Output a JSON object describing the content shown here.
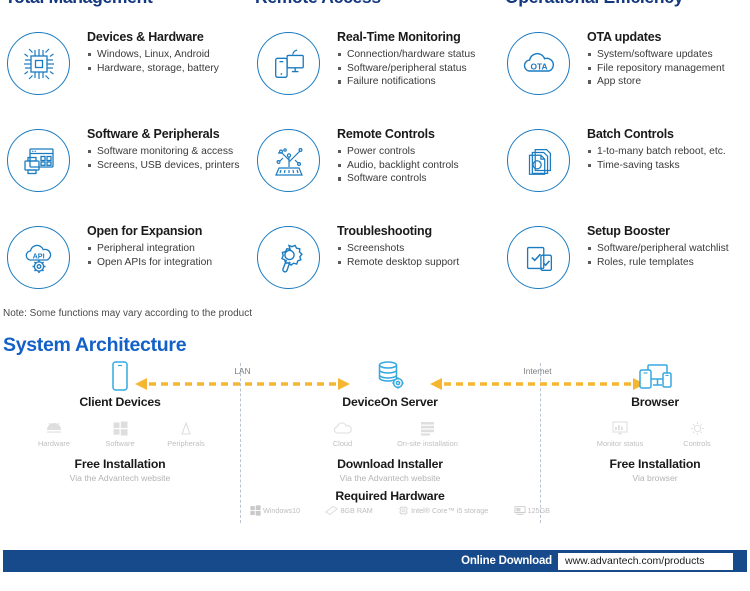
{
  "columns": [
    {
      "title": "Total Management"
    },
    {
      "title": "Remote Access"
    },
    {
      "title": "Operational Efficiency"
    }
  ],
  "features": [
    {
      "icon": "chip-icon",
      "title": "Devices & Hardware",
      "bullets": [
        "Windows, Linux, Android",
        "Hardware, storage, battery"
      ]
    },
    {
      "icon": "real-time-monitoring-icon",
      "title": "Real-Time Monitoring",
      "bullets": [
        "Connection/hardware status",
        "Software/peripheral status",
        "Failure notifications"
      ]
    },
    {
      "icon": "cloud-ota-icon",
      "title": "OTA updates",
      "bullets": [
        "System/software updates",
        "File repository management",
        "App store"
      ]
    },
    {
      "icon": "software-peripherals-icon",
      "title": "Software & Peripherals",
      "bullets": [
        "Software monitoring & access",
        "Screens, USB devices, printers"
      ]
    },
    {
      "icon": "remote-controls-icon",
      "title": "Remote Controls",
      "bullets": [
        "Power controls",
        "Audio, backlight controls",
        "Software controls"
      ]
    },
    {
      "icon": "batch-controls-icon",
      "title": "Batch Controls",
      "bullets": [
        "1-to-many batch reboot, etc.",
        "Time-saving tasks"
      ]
    },
    {
      "icon": "api-cloud-icon",
      "title": "Open for Expansion",
      "bullets": [
        "Peripheral integration",
        "Open APIs for integration"
      ]
    },
    {
      "icon": "gear-wrench-icon",
      "title": "Troubleshooting",
      "bullets": [
        "Screenshots",
        "Remote desktop support"
      ]
    },
    {
      "icon": "setup-booster-icon",
      "title": "Setup Booster",
      "bullets": [
        "Software/peripheral watchlist",
        "Roles, rule templates"
      ]
    }
  ],
  "note": "Note: Some functions may vary according to the product",
  "architecture": {
    "section_title": "System Architecture",
    "links": [
      {
        "label": "LAN"
      },
      {
        "label": "Internet"
      }
    ],
    "nodes": [
      {
        "icon": "mobile-device-icon",
        "label": "Client Devices",
        "subicons": [
          {
            "icon": "android-icon",
            "label": "Hardware"
          },
          {
            "icon": "windows-icon",
            "label": "Software"
          },
          {
            "icon": "peripheral-icon",
            "label": "Peripherals"
          }
        ],
        "blocks": [
          {
            "title": "Free Installation",
            "sub": "Via the Advantech website"
          }
        ]
      },
      {
        "icon": "server-database-icon",
        "label": "DeviceOn Server",
        "subicons": [
          {
            "icon": "cloud-icon",
            "label": "Cloud"
          },
          {
            "icon": "onsite-server-icon",
            "label": "On-site installation"
          }
        ],
        "blocks": [
          {
            "title": "Download Installer",
            "sub": "Via the Advantech website"
          },
          {
            "title": "Required Hardware",
            "sub": ""
          }
        ]
      },
      {
        "icon": "browser-devices-icon",
        "label": "Browser",
        "subicons": [
          {
            "icon": "monitor-status-icon",
            "label": "Monitor status"
          },
          {
            "icon": "controls-gear-icon",
            "label": "Controls"
          }
        ],
        "blocks": [
          {
            "title": "Free Installation",
            "sub": "Via browser"
          }
        ]
      }
    ],
    "hardware_requirements": [
      {
        "icon": "windows-logo-icon",
        "label": "Windows10"
      },
      {
        "icon": "ram-icon",
        "label": "8GB RAM"
      },
      {
        "icon": "cpu-icon",
        "label": "Intel® Core™ i5 storage"
      },
      {
        "icon": "storage-icon",
        "label": "125GB"
      }
    ]
  },
  "footer": {
    "download_label": "Online Download",
    "url": "www.advantech.com/products"
  },
  "colors": {
    "heading_navy": "#13387e",
    "accent_blue": "#1b7bc0",
    "section_blue": "#1360c8",
    "arrow_yellow": "#f5b731",
    "footer_bar": "#174a8b"
  }
}
